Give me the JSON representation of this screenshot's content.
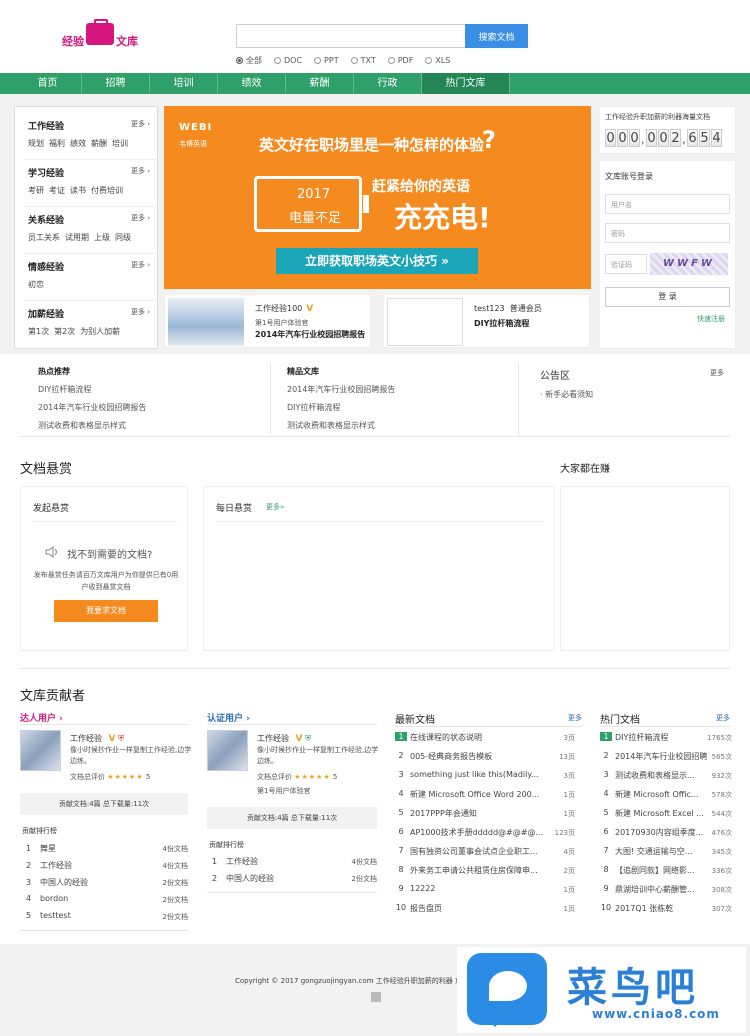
{
  "logo": {
    "left": "经验",
    "right": "文库"
  },
  "search": {
    "placeholder": "",
    "button": "搜索文档",
    "types": [
      "全部",
      "DOC",
      "PPT",
      "TXT",
      "PDF",
      "XLS"
    ],
    "selected": "全部"
  },
  "nav": [
    "首页",
    "招聘",
    "培训",
    "绩效",
    "薪酬",
    "行政",
    "热门文库"
  ],
  "categories": [
    {
      "title": "工作经验",
      "more": "更多 ›",
      "subs": [
        "规划",
        "福利",
        "绩效",
        "薪酬",
        "培训"
      ]
    },
    {
      "title": "学习经验",
      "more": "更多 ›",
      "subs": [
        "考研",
        "考证",
        "读书",
        "付费培训"
      ]
    },
    {
      "title": "关系经验",
      "more": "更多 ›",
      "subs": [
        "员工关系",
        "试用期",
        "上级",
        "同级"
      ]
    },
    {
      "title": "情感经验",
      "more": "更多 ›",
      "subs": [
        "初恋"
      ]
    },
    {
      "title": "加薪经验",
      "more": "更多 ›",
      "subs": [
        "第1次",
        "第2次",
        "为别人加薪"
      ]
    }
  ],
  "banner": {
    "logo": "WEBI",
    "logo_sub": "韦博英语",
    "title": "英文好在职场里是一种怎样的体验",
    "q": "?",
    "year": "2017",
    "battery": "电量不足",
    "sub1": "赶紧给你的英语",
    "sub2": "充充电!",
    "cta": "立即获取职场英文小技巧 »"
  },
  "doc_cards": [
    {
      "user": "工作经验100",
      "badge": "V",
      "role": "第1号用户体验官",
      "title": "2014年汽车行业校园招聘报告"
    },
    {
      "user": "test123",
      "badge": "普通会员",
      "role": "",
      "title": "DIY拉杆箱流程"
    }
  ],
  "counter": {
    "label": "工作经验升职加薪的利器海量文档",
    "digits": [
      "0",
      "0",
      "0",
      "0",
      "0",
      "2",
      "6",
      "5",
      "4"
    ]
  },
  "login": {
    "title": "文库账号登录",
    "user": "用户名",
    "pass": "密码",
    "captcha_ph": "验证码",
    "captcha": "WWFW",
    "button": "登 录",
    "register": "快速注册"
  },
  "hot": {
    "title": "热点推荐",
    "items": [
      "DIY拉杆箱流程",
      "2014年汽车行业校园招聘报告",
      "测试收费和表格显示样式"
    ]
  },
  "fine": {
    "title": "精品文库",
    "items": [
      "2014年汽车行业校园招聘报告",
      "DIY拉杆箱流程",
      "测试收费和表格显示样式"
    ]
  },
  "notice": {
    "title": "公告区",
    "more": "更多",
    "items": [
      "· 新手必看须知"
    ]
  },
  "bounty": {
    "title": "文档悬赏",
    "earn": "大家都在赚",
    "start": "发起悬赏",
    "daily": "每日悬赏",
    "daily_more": "更多»",
    "notfound": "找不到需要的文档?",
    "desc": "发布悬赏任务请百万文库用户为你提供已有0用户收到悬赏文档",
    "button": "我要求文档"
  },
  "contrib": {
    "title": "文库贡献者",
    "expert": {
      "label": "达人用户 ›",
      "name": "工作经验",
      "desc": "像小时候抄作业一样复制工作经验,边学边练。",
      "rate": "文档总评价",
      "stars": "★★★★★",
      "score": "5",
      "stat": "贡献文档:4篇  总下载量:11次",
      "rank_title": "贡献排行榜",
      "ranks": [
        [
          "1",
          "舞星",
          "4份文档"
        ],
        [
          "2",
          "工作经验",
          "4份文档"
        ],
        [
          "3",
          "中国人的经验",
          "2份文档"
        ],
        [
          "4",
          "bordon",
          "2份文档"
        ],
        [
          "5",
          "testtest",
          "2份文档"
        ]
      ]
    },
    "certified": {
      "label": "认证用户 ›",
      "name": "工作经验",
      "desc": "像小时候抄作业一样复制工作经验,边学边练。",
      "rate": "文档总评价",
      "stars": "★★★★★",
      "score": "5",
      "role": "第1号用户体验官",
      "stat": "贡献文档:4篇  总下载量:11次",
      "rank_title": "贡献排行榜",
      "ranks": [
        [
          "1",
          "工作经验",
          "4份文档"
        ],
        [
          "2",
          "中国人的经验",
          "2份文档"
        ]
      ]
    }
  },
  "latest": {
    "title": "最新文档",
    "more": "更多",
    "items": [
      [
        "1",
        "在线课程的状态说明",
        "3页"
      ],
      [
        "2",
        "005-经典商务报告模板",
        "13页"
      ],
      [
        "3",
        "something just like this(Madily...",
        "3页"
      ],
      [
        "4",
        "新建 Microsoft Office Word 200...",
        "1页"
      ],
      [
        "5",
        "2017PPP年会通知",
        "1页"
      ],
      [
        "6",
        "AP1000技术手册ddddd@#@#@...",
        "123页"
      ],
      [
        "7",
        "国有独资公司董事会试点企业职工...",
        "4页"
      ],
      [
        "8",
        "外来务工申请公共租赁住房保障申...",
        "2页"
      ],
      [
        "9",
        "12222",
        "1页"
      ],
      [
        "10",
        "报告盘页",
        "1页"
      ]
    ]
  },
  "popular": {
    "title": "热门文档",
    "more": "更多",
    "items": [
      [
        "1",
        "DIY拉杆箱流程",
        "1765次"
      ],
      [
        "2",
        "2014年汽车行业校园招聘报",
        "565次"
      ],
      [
        "3",
        "测试收费和表格显示...",
        "932次"
      ],
      [
        "4",
        "新建 Microsoft Offic...",
        "578次"
      ],
      [
        "5",
        "新建 Microsoft Excel ...",
        "544次"
      ],
      [
        "6",
        "20170930内容组季度...",
        "476次"
      ],
      [
        "7",
        "大图! 交通运输与空...",
        "345次"
      ],
      [
        "8",
        "【追剧同款】网络影...",
        "336次"
      ],
      [
        "9",
        "鼎湖培训中心薪酬管...",
        "308次"
      ],
      [
        "10",
        "2017Q1 张栋乾",
        "307次"
      ]
    ]
  },
  "footer": {
    "copy": "Copyright © 2017 gongzuojingyan.com 工作经验升职加薪的利器 京IC"
  },
  "watermark": {
    "text": "菜鸟吧",
    "url": "www.cniao8.com"
  },
  "colors": {
    "nav": "#2fa06a",
    "brand": "#d6167e",
    "accent": "#f58a1f",
    "link": "#2b6fb8"
  }
}
